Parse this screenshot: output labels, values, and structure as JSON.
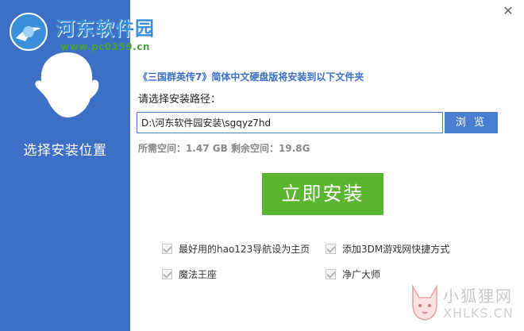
{
  "watermark": {
    "name": "河东软件园",
    "url": "www.pc0359.cn"
  },
  "sidebar": {
    "title": "选择安装位置"
  },
  "window": {
    "close_glyph": "✕"
  },
  "main": {
    "install_note": "《三国群英传7》简体中文硬盘版将安装到以下文件夹",
    "path_label": "请选择安装路径：",
    "path_value": "D:\\河东软件园安装\\sgqyz7hd",
    "browse_label": "浏 览",
    "space_info": "所需空间：1.47 GB  剩余空间：19.8G",
    "install_label": "立即安装"
  },
  "options": [
    {
      "label": "最好用的hao123导航设为主页",
      "checked": true
    },
    {
      "label": "添加3DM游戏网快捷方式",
      "checked": true
    },
    {
      "label": "魔法王座",
      "checked": true
    },
    {
      "label": "净广大师",
      "checked": true
    }
  ],
  "corner_logo": {
    "cn": "小狐狸网",
    "en": "XHLKS.CN"
  },
  "colors": {
    "sidebar": "#3d6fc4",
    "accent": "#4a7fd0",
    "install": "#5cb531"
  }
}
